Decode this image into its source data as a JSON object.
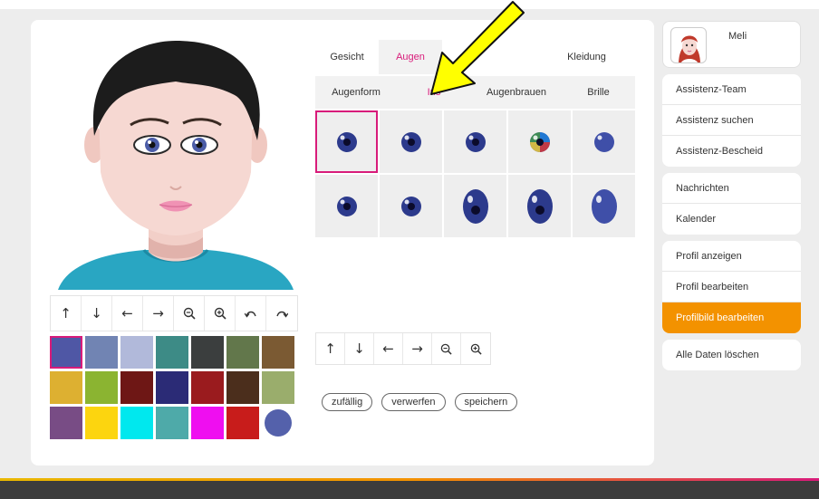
{
  "tabs": [
    {
      "label": "Gesicht",
      "active": false
    },
    {
      "label": "Augen",
      "active": true
    },
    {
      "label": "",
      "active": false
    },
    {
      "label": "Kleidung",
      "active": false
    }
  ],
  "subtabs": [
    {
      "label": "Augenform",
      "active": false
    },
    {
      "label": "Iris",
      "active": true
    },
    {
      "label": "Augenbrauen",
      "active": false
    },
    {
      "label": "Brille",
      "active": false
    }
  ],
  "avatar_toolbar": [
    "arrow-up-icon",
    "arrow-down-icon",
    "arrow-left-icon",
    "arrow-right-icon",
    "zoom-out-icon",
    "zoom-in-icon",
    "undo-icon",
    "redo-icon"
  ],
  "feature_toolbar": [
    "arrow-up-icon",
    "arrow-down-icon",
    "arrow-left-icon",
    "arrow-right-icon",
    "zoom-out-icon",
    "zoom-in-icon"
  ],
  "palette": {
    "colors": [
      "#4f57a5",
      "#7184b3",
      "#b1b9da",
      "#3d8b86",
      "#3b3e3e",
      "#62774b",
      "#7b5a33",
      "#ddb031",
      "#8bb431",
      "#6e1715",
      "#2b2b76",
      "#9a1b1e",
      "#4b2e1c",
      "#9aad6c",
      "#784c85",
      "#fcd50f",
      "#00e8ee",
      "#4eaaa9",
      "#ef0ef0",
      "#c81c1b",
      "#5461ab"
    ],
    "selected_index": 0
  },
  "iris_options": [
    {
      "color": "#2c3a8c",
      "style": "dot"
    },
    {
      "color": "#2c3a8c",
      "style": "dark"
    },
    {
      "color": "#2c3a8c",
      "style": "dark"
    },
    {
      "color": "#2c3a8c",
      "style": "multicolor"
    },
    {
      "color": "#3f4fa8",
      "style": "plain"
    },
    {
      "color": "#2c3a8c",
      "style": "dark"
    },
    {
      "color": "#2c3a8c",
      "style": "dark"
    },
    {
      "color": "#2c3a8c",
      "style": "tall"
    },
    {
      "color": "#2c3a8c",
      "style": "tall"
    },
    {
      "color": "#3f4fa8",
      "style": "tall-plain"
    }
  ],
  "iris_selected_index": 0,
  "actions": {
    "random": "zufällig",
    "discard": "verwerfen",
    "save": "speichern"
  },
  "profile": {
    "name": "Meli"
  },
  "menu_groups": [
    {
      "items": [
        "Assistenz-Team",
        "Assistenz suchen",
        "Assistenz-Bescheid"
      ]
    },
    {
      "items": [
        "Nachrichten",
        "Kalender"
      ]
    },
    {
      "items": [
        "Profil anzeigen",
        "Profil bearbeiten",
        "Profilbild bearbeiten"
      ],
      "active": "Profilbild bearbeiten"
    },
    {
      "items": [
        "Alle Daten löschen"
      ]
    }
  ],
  "colors": {
    "accent": "#d81b7a",
    "menu_active": "#f39200",
    "arrow": "#ffff00"
  }
}
